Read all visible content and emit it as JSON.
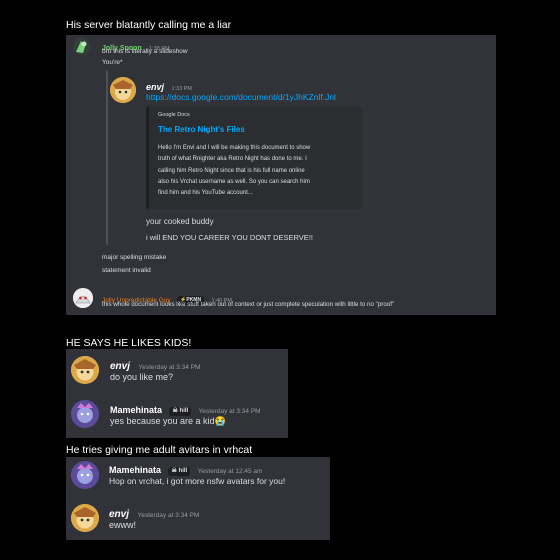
{
  "captions": {
    "c1": "His server blatantly calling me a liar",
    "c2": "HE SAYS HE LIKES KIDS!",
    "c3": "He tries giving me adult avitars in vrhcat"
  },
  "panel1": {
    "jolly": {
      "name": "Jolly Spoon",
      "time": "1:38 PM",
      "line1": "bro this is literally a slideshow",
      "line2": "You're*"
    },
    "quoted": {
      "name": "envj",
      "time": "1:33 PM",
      "url": "https://docs.google.com/document/d/1yJhKZnlf.Jnl",
      "embed": {
        "provider": "Google Docs",
        "title": "The Retro Night's Files",
        "desc": [
          "Hello I'm Envi and I will be making this document to show",
          "truth of what Rnighter aka Retro Night has done to me. I",
          "calling him Retro Night since that is his full name online",
          "also his Vrchat username as well. So you can search him",
          "find him and his YouTube account..."
        ]
      },
      "line1": "your cooked buddy",
      "line2": "i will END YOU CAREER YOU DONT DESERVE!!"
    },
    "after1": "major spelling mistake",
    "after2": "statement invalid",
    "guy": {
      "name": "Jolly Unpredictable Guy",
      "tag": "⚡PKMN",
      "time": "1:40 PM",
      "text": "this whole document looks like stuff taken out of context or just complete speculation with little to no \"proof\""
    }
  },
  "panel2": {
    "envj": {
      "name": "envj",
      "time": "Yesterday at 3:34 PM",
      "text": "do you like me?"
    },
    "mame": {
      "name": "Mamehinata",
      "tag": "hill",
      "time": "Yesterday at 3:34 PM",
      "text": "yes because you are a kid😭"
    }
  },
  "panel3": {
    "mame": {
      "name": "Mamehinata",
      "tag": "hill",
      "time": "Yesterday at 12:45 am",
      "text": "Hop on vrchat, i got more nsfw avatars for you!"
    },
    "envj": {
      "name": "envj",
      "time": "Yesterday at 3:34 PM",
      "text": "ewww!"
    }
  },
  "colors": {
    "background": "#000000",
    "panel": "#313338",
    "embed": "#2b2d31",
    "link": "#00a8fc",
    "jolly_spoon": "#6fd06d",
    "jolly_guy": "#e67e22",
    "envj": "#ffffff",
    "mamehinata": "#ffffff"
  },
  "icons": {
    "tag_icon": "skull-icon"
  }
}
